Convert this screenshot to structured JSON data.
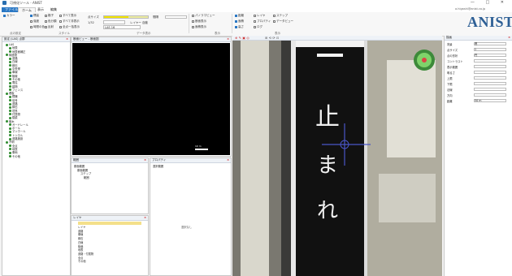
{
  "window": {
    "title": "可視化ツール - ANIST",
    "controls": "— □ ✕"
  },
  "ribbon_tabs": [
    "ファイル",
    "ホーム",
    "表示",
    "編集"
  ],
  "ribbon": {
    "col1": [
      "カラー",
      ""
    ],
    "col2": [
      "標高",
      "強度",
      "時間の色"
    ],
    "col3": [
      "格子",
      "色分類",
      "反射"
    ],
    "col4": [
      "すべて表示",
      "すべて非表示",
      "全点一括表示"
    ],
    "slider_label": "点サイズ",
    "slider_value": 0.55,
    "dd1": "1/32",
    "dd1_label": "間隔",
    "dd2": "LAS 16",
    "dd2_label": "レイヤー 自動",
    "col5": [
      "パノラマビュー",
      "断面表示",
      "面積表示"
    ],
    "col6": [
      "距離",
      "面積",
      "高さ"
    ],
    "col7": [
      "レイヤ",
      "プロパティ",
      "ログ"
    ],
    "col8": [
      "ステップ",
      "データビュー"
    ],
    "groups": [
      "点の設定",
      "スタイル",
      "データ表示",
      "表示",
      "表示"
    ],
    "user": "a.higashi@anist.co.jp",
    "logo": "ANIST"
  },
  "left_panel": {
    "title": "設定 (LAS) 点群",
    "layers": [
      "LAS",
      "地表",
      "地表面補正",
      "構造物",
      "道路",
      "白線",
      "縁石",
      "中央帯",
      "車線",
      "植栽",
      "その他",
      "電柱",
      "建物",
      "フェンス",
      "看板",
      "標識",
      "信号",
      "道路",
      "縁石",
      "境界",
      "付属物",
      "橋梁",
      "樹木",
      "ガードレール",
      "ポール",
      "マンホール",
      "トンネル",
      "道路施設",
      "不明",
      "全点",
      "地表",
      "車両",
      "その他"
    ]
  },
  "view_panel": {
    "title": "断面ビュー - 断面図",
    "scale": "10 m"
  },
  "bottom_left": {
    "title": "範囲",
    "items": [
      "断面範囲",
      "断面範囲",
      "ステップ",
      "範囲"
    ]
  },
  "bottom_mid": {
    "title": "プロパティ",
    "subtitle": "選択範囲",
    "empty": "選択なし"
  },
  "bottom_left2": {
    "title": "レイヤ",
    "items": [
      "レイヤ",
      "道路",
      "車線",
      "縁石",
      "白線",
      "植栽",
      "地表",
      "道路・付属物",
      "全点",
      "その他"
    ]
  },
  "road_text": [
    "止",
    "ま",
    "れ"
  ],
  "right_panel": {
    "title": "描画",
    "rows": [
      "背景",
      "点サイズ",
      "点の形状",
      "コントラスト",
      "表示範囲",
      "明るさ",
      "上限",
      "下限",
      "法線",
      "方向",
      "距離"
    ],
    "values": [
      "黒",
      "1",
      "円",
      "",
      "",
      "",
      "",
      "",
      "",
      "",
      "50 m"
    ]
  }
}
